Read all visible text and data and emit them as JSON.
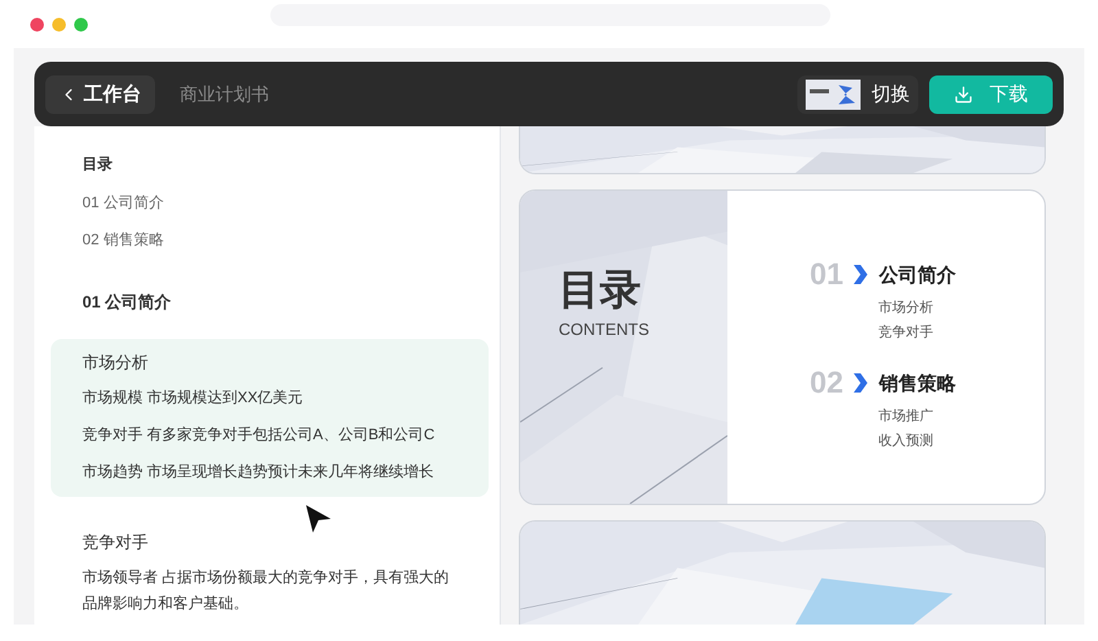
{
  "window": {
    "controls": [
      {
        "color": "#ef4560"
      },
      {
        "color": "#f6bd2b"
      },
      {
        "color": "#2fc84a"
      }
    ]
  },
  "toolbar": {
    "back_button": "工作台",
    "document_title": "商业计划书",
    "switch_button": "切换",
    "download_button": "下载"
  },
  "outline": {
    "heading": "目录",
    "items": [
      "01 公司简介",
      "02 销售策略"
    ],
    "section_title": "01 公司简介",
    "blocks": [
      {
        "title": "市场分析",
        "selected": true,
        "lines": [
          "市场规模 市场规模达到XX亿美元",
          "竞争对手 有多家竞争对手包括公司A、公司B和公司C",
          "市场趋势 市场呈现增长趋势预计未来几年将继续增长"
        ]
      },
      {
        "title": "竞争对手",
        "selected": false,
        "lines": [
          "市场领导者 占据市场份额最大的竞争对手，具有强大的品牌影响力和客户基础。"
        ]
      }
    ]
  },
  "slides": [
    {
      "kind": "picture"
    },
    {
      "kind": "contents",
      "title": "目录",
      "subtitle": "CONTENTS",
      "sections": [
        {
          "number": "01",
          "title": "公司简介",
          "items": [
            "市场分析",
            "竞争对手"
          ]
        },
        {
          "number": "02",
          "title": "销售策略",
          "items": [
            "市场推广",
            "收入预测"
          ]
        }
      ]
    },
    {
      "kind": "picture"
    }
  ]
}
